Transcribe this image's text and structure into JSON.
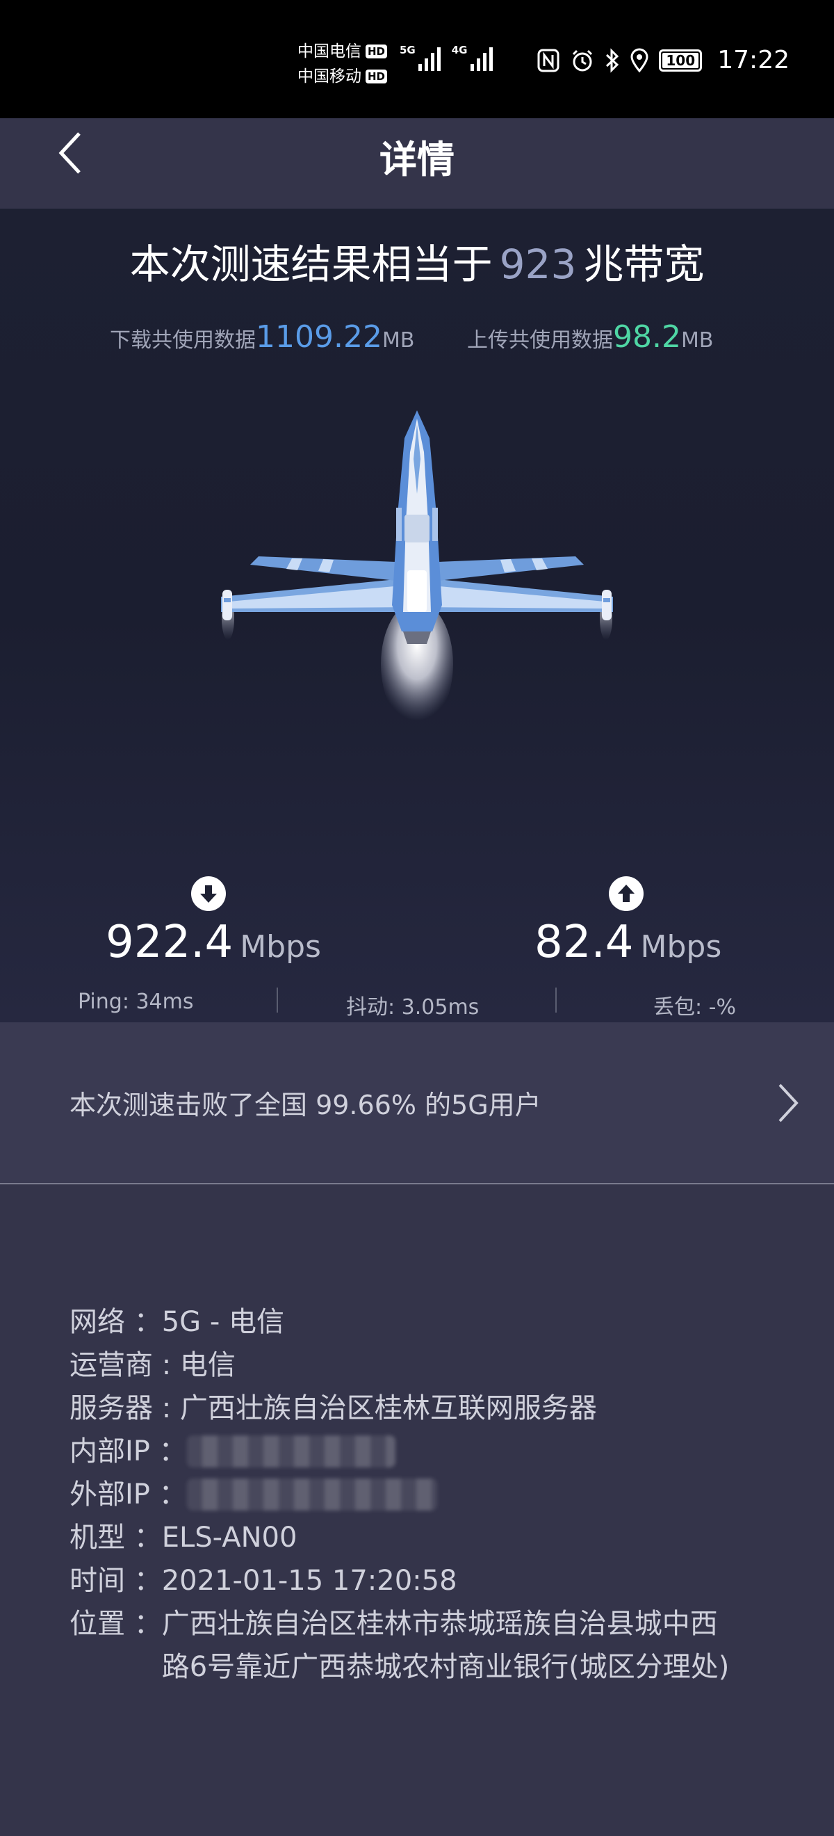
{
  "status_bar": {
    "carrier1": "中国电信",
    "carrier2": "中国移动",
    "hd_label": "HD",
    "net1": "5G",
    "net2": "4G",
    "battery": "100",
    "time": "17:22"
  },
  "header": {
    "title": "详情"
  },
  "hero": {
    "headline_prefix": "本次测速结果相当于",
    "bandwidth": "923",
    "headline_suffix": "兆带宽",
    "download_used_label": "下载共使用数据",
    "download_used_value": "1109.22",
    "upload_used_label": "上传共使用数据",
    "upload_used_value": "98.2",
    "data_unit": "MB"
  },
  "speeds": {
    "download_value": "922.4",
    "upload_value": "82.4",
    "unit": "Mbps"
  },
  "stats": {
    "ping": "Ping:  34ms",
    "jitter": "抖动:  3.05ms",
    "loss": "丢包:  -%"
  },
  "rank": {
    "text": "本次测速击败了全国 99.66% 的5G用户"
  },
  "details": {
    "network_label": "网络 ：",
    "network_value": "5G - 电信",
    "operator_label": "运营商 : ",
    "operator_value": "电信",
    "server_label": "服务器 : ",
    "server_value": "广西壮族自治区桂林互联网服务器",
    "internal_ip_label": "内部IP ：",
    "external_ip_label": "外部IP ：",
    "model_label": "机型 ：",
    "model_value": "ELS-AN00",
    "time_label": "时间 ：",
    "time_value": "2021-01-15 17:20:58",
    "location_label": "位置 ：",
    "location_value": "广西壮族自治区桂林市恭城瑶族自治县城中西路6号靠近广西恭城农村商业银行(城区分理处)"
  },
  "colors": {
    "download_accent": "#5a9ce8",
    "upload_accent": "#4fd6a4",
    "bandwidth_accent": "#9aa3c6"
  }
}
